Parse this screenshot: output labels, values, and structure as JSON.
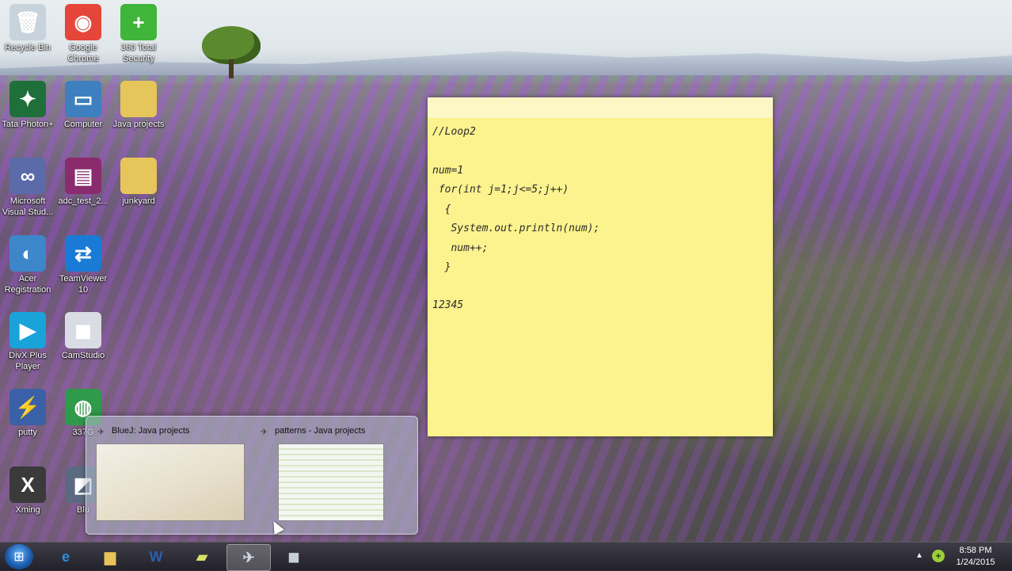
{
  "desktop": {
    "icons": [
      {
        "label": "Recycle Bin",
        "glyph": "🗑",
        "bg": "#c9d3dc"
      },
      {
        "label": "Google Chrome",
        "glyph": "◉",
        "bg": "#e6453a"
      },
      {
        "label": "360 Total Security",
        "glyph": "+",
        "bg": "#3fb53a"
      },
      {
        "label": "Tata Photon+",
        "glyph": "✦",
        "bg": "#1f6f3a"
      },
      {
        "label": "Computer",
        "glyph": "▭",
        "bg": "#3d7fbf"
      },
      {
        "label": "Java projects",
        "glyph": "",
        "bg": "#e6c65b"
      },
      {
        "label": "Microsoft Visual Stud...",
        "glyph": "∞",
        "bg": "#5b6aa9"
      },
      {
        "label": "adc_test_2...",
        "glyph": "▤",
        "bg": "#8a2b6d"
      },
      {
        "label": "junkyard",
        "glyph": "",
        "bg": "#e6c65b"
      },
      {
        "label": "Acer Registration",
        "glyph": "◐",
        "bg": "#3c86c9"
      },
      {
        "label": "TeamViewer 10",
        "glyph": "⇄",
        "bg": "#1a7bd6"
      },
      {
        "label": "DivX Plus Player",
        "glyph": "▶",
        "bg": "#1aa3d9"
      },
      {
        "label": "CamStudio",
        "glyph": "◼",
        "bg": "#d9dde3"
      },
      {
        "label": "putty",
        "glyph": "⚡",
        "bg": "#3a60a8"
      },
      {
        "label": "337G",
        "glyph": "◍",
        "bg": "#2f9a4a"
      },
      {
        "label": "Xming",
        "glyph": "X",
        "bg": "#3a3a3a"
      },
      {
        "label": "Blu",
        "glyph": "◩",
        "bg": "#5b6a80"
      }
    ]
  },
  "sticky_note": {
    "lines": [
      "//Loop2",
      "",
      "num=1",
      " for(int j=1;j<=5;j++)",
      "  {",
      "   System.out.println(num);",
      "   num++;",
      "  }",
      "",
      "12345"
    ]
  },
  "preview": {
    "windows": [
      {
        "title": "BlueJ: Java projects"
      },
      {
        "title": "patterns - Java projects"
      }
    ]
  },
  "taskbar": {
    "start_glyph": "⊞",
    "buttons": [
      {
        "name": "internet-explorer",
        "glyph": "e",
        "color": "#2b8fe0"
      },
      {
        "name": "file-explorer",
        "glyph": "▆",
        "color": "#e8c35a"
      },
      {
        "name": "word",
        "glyph": "W",
        "color": "#2b5fb3"
      },
      {
        "name": "sticky-notes",
        "glyph": "▰",
        "color": "#d6e06a"
      },
      {
        "name": "bluej",
        "glyph": "✈",
        "color": "#d0d6e0"
      },
      {
        "name": "camstudio",
        "glyph": "◼",
        "color": "#c9cfd8"
      }
    ],
    "tray_arrow": "▲",
    "tray_icon": "+",
    "time": "8:58 PM",
    "date": "1/24/2015"
  },
  "colors": {
    "note_bg": "#fcf38f"
  }
}
